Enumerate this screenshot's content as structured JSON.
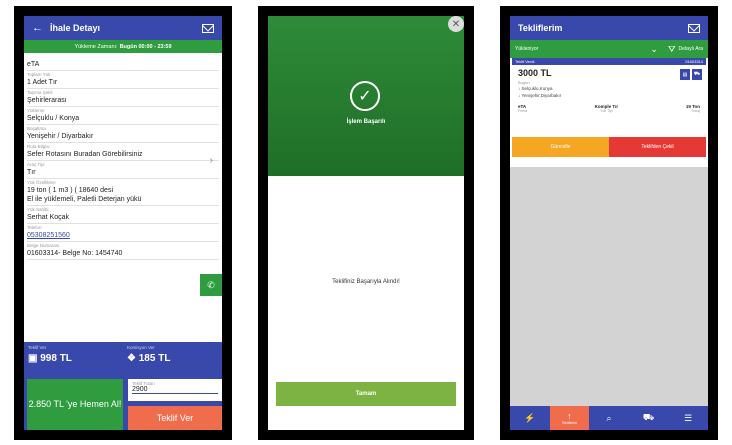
{
  "screen1": {
    "title": "İhale Detayı",
    "timebar_label": "Yükleme Zamanı:",
    "timebar_value": "Bugün 00:00 - 23:59",
    "fields": [
      {
        "label": "",
        "value": "eTA"
      },
      {
        "label": "Toplam Yük",
        "value": "1 Adet Tır"
      },
      {
        "label": "Taşıma Şekli",
        "value": "Şehirlerarası"
      },
      {
        "label": "Yükleme",
        "value": "Selçuklu / Konya"
      },
      {
        "label": "Boşaltma",
        "value": "Yenişehir / Diyarbakır"
      },
      {
        "label": "Rota Bilgisi",
        "value": "Sefer Rotasını Buradan Görebilirsiniz"
      },
      {
        "label": "Araç Tipi",
        "value": "Tır"
      },
      {
        "label": "Yük Özellikleri",
        "value": "19 ton ( 1 m3 ) ( 18640 desi\nEl ile yüklemeli, Paletli Deterjan yükü"
      },
      {
        "label": "Yük Sahibi",
        "value": "Serhat Koçak"
      },
      {
        "label": "Telefon",
        "value": "05308251560"
      },
      {
        "label": "Belge Numarası",
        "value": "01603314- Belge No: 1454740"
      }
    ],
    "price_label": "Teklif Ver",
    "price_value": "998 TL",
    "commission_label": "Komisyon Ver",
    "commission_value": "185 TL",
    "hemen_button": "2.850 TL 'ye Hemen Al!",
    "bid_label": "Teklif Tutarı",
    "bid_value": "2900",
    "bid_button": "Teklif Ver"
  },
  "screen2": {
    "success_title": "İşlem Başarılı",
    "message": "Teklifiniz Başarıyla Alındı!",
    "ok_button": "Tamam"
  },
  "screen3": {
    "title": "Tekliflerim",
    "filter_select": "Yükleniyor",
    "filter_button": "Detaylı Ara",
    "card_header_left": "Teklif Verdi",
    "card_header_right": "01603314",
    "price": "3000 TL",
    "route_label": "Bugün",
    "route_from": "Selçuklu,Konya",
    "route_to": "Yenişehir,Diyarbakır",
    "stats": [
      {
        "value": "eTA",
        "label": "Firma"
      },
      {
        "value": "Komple Tır",
        "label": "Yük Tipi"
      },
      {
        "value": "19 Ton",
        "label": "Tonaj"
      }
    ],
    "edit_button": "Güncelle",
    "withdraw_button": "Teklifden Çekil",
    "nav": [
      {
        "icon": "⚡",
        "label": ""
      },
      {
        "icon": "↑",
        "label": "Tekliflerim"
      },
      {
        "icon": "⌕",
        "label": ""
      },
      {
        "icon": "⛟",
        "label": ""
      },
      {
        "icon": "☰",
        "label": ""
      }
    ]
  }
}
